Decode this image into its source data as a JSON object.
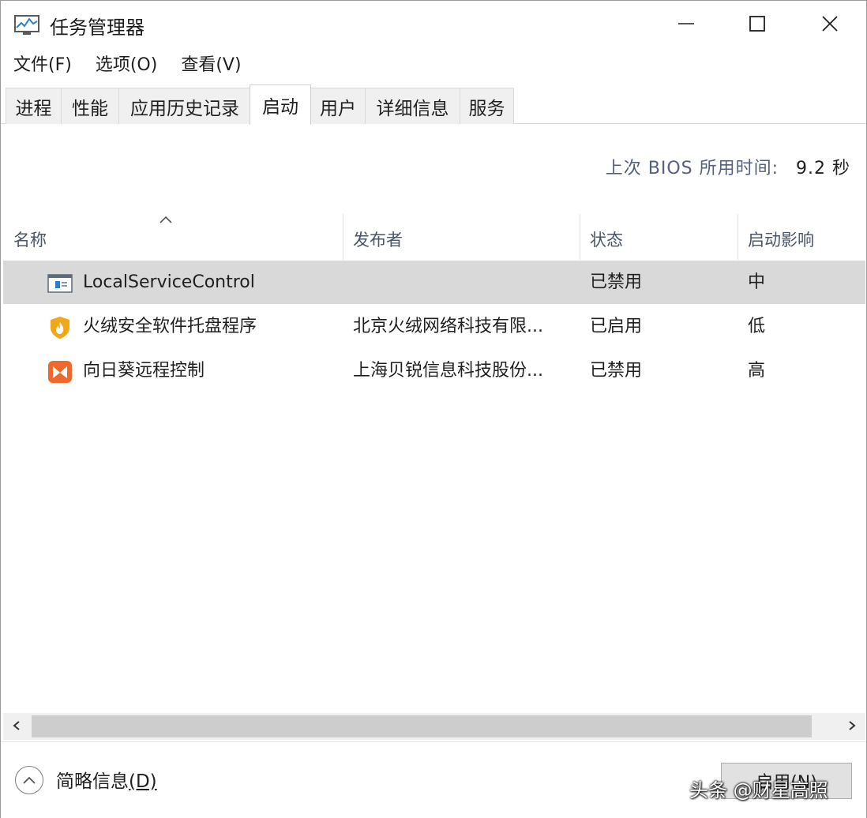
{
  "window": {
    "title": "任务管理器",
    "app_icon": "task-manager-icon",
    "controls": {
      "minimize": "minimize-icon",
      "maximize": "maximize-icon",
      "close": "close-icon"
    }
  },
  "menu": [
    {
      "label": "文件(F)"
    },
    {
      "label": "选项(O)"
    },
    {
      "label": "查看(V)"
    }
  ],
  "tabs": [
    {
      "label": "进程",
      "active": false
    },
    {
      "label": "性能",
      "active": false
    },
    {
      "label": "应用历史记录",
      "active": false
    },
    {
      "label": "启动",
      "active": true
    },
    {
      "label": "用户",
      "active": false
    },
    {
      "label": "详细信息",
      "active": false
    },
    {
      "label": "服务",
      "active": false
    }
  ],
  "bios": {
    "label": "上次 BIOS 所用时间:",
    "value": "9.2 秒"
  },
  "table": {
    "sorted_column": "名称",
    "columns": [
      {
        "label": "名称"
      },
      {
        "label": "发布者"
      },
      {
        "label": "状态"
      },
      {
        "label": "启动影响"
      }
    ],
    "rows": [
      {
        "icon": "window-app-icon",
        "name": "LocalServiceControl",
        "publisher": "",
        "status": "已禁用",
        "impact": "中",
        "selected": true
      },
      {
        "icon": "shield-flame-icon",
        "name": "火绒安全软件托盘程序",
        "publisher": "北京火绒网络科技有限...",
        "status": "已启用",
        "impact": "低",
        "selected": false
      },
      {
        "icon": "sunlogin-icon",
        "name": "向日葵远程控制",
        "publisher": "上海贝锐信息科技股份...",
        "status": "已禁用",
        "impact": "高",
        "selected": false
      }
    ]
  },
  "footer": {
    "brief_label": "简略信息",
    "brief_shortcut": "(D)",
    "action_label": "启用(N)"
  },
  "watermark": "头条 @财星高照",
  "colors": {
    "selected_row": "#d9d9d9",
    "header_text": "#4a5566",
    "accent_orange": "#f0692c",
    "shield_yellow": "#f2a71b"
  }
}
